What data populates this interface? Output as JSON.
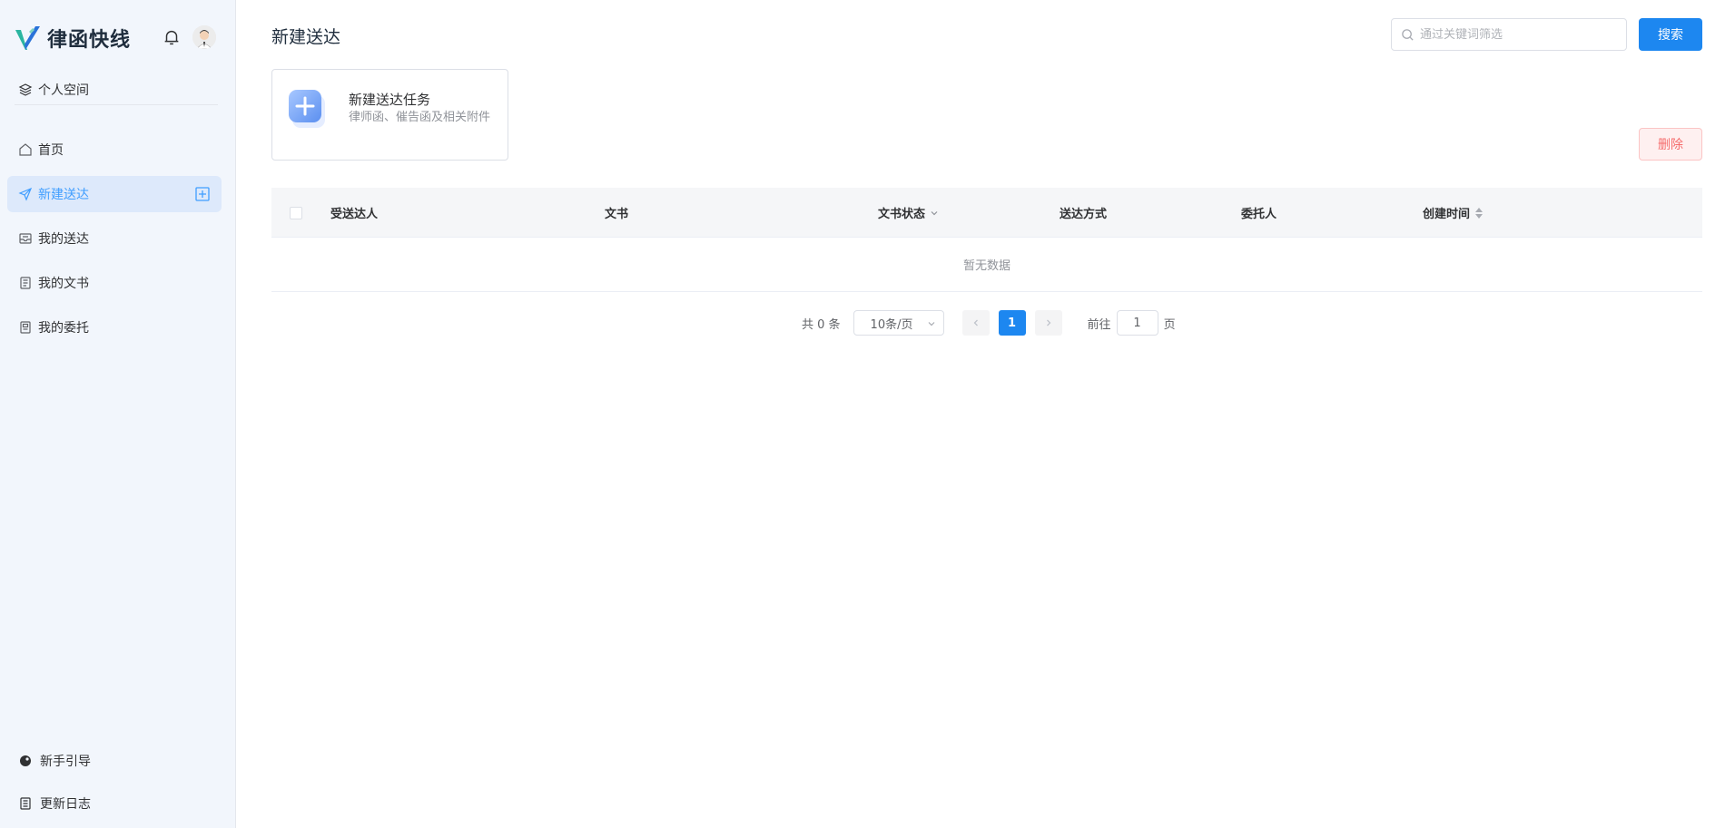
{
  "app": {
    "brand": "律函快线"
  },
  "sidebar": {
    "space_label": "个人空间",
    "items": [
      {
        "label": "首页",
        "icon": "home-icon"
      },
      {
        "label": "新建送达",
        "icon": "send-icon",
        "active": true
      },
      {
        "label": "我的送达",
        "icon": "inbox-icon"
      },
      {
        "label": "我的文书",
        "icon": "document-icon"
      },
      {
        "label": "我的委托",
        "icon": "entrust-icon"
      }
    ],
    "bottom": [
      {
        "label": "新手引导",
        "icon": "guide-icon"
      },
      {
        "label": "更新日志",
        "icon": "changelog-icon"
      }
    ]
  },
  "header": {
    "title": "新建送达",
    "search_placeholder": "通过关键词筛选",
    "search_button": "搜索"
  },
  "task_card": {
    "title": "新建送达任务",
    "desc": "律师函、催告函及相关附件"
  },
  "actions": {
    "delete": "删除"
  },
  "table": {
    "columns": [
      "受送达人",
      "文书",
      "文书状态",
      "送达方式",
      "委托人",
      "创建时间"
    ],
    "empty_text": "暂无数据"
  },
  "pagination": {
    "total_text": "共 0 条",
    "page_size": "10条/页",
    "current_page": "1",
    "goto_prefix": "前往",
    "goto_value": "1",
    "goto_suffix": "页"
  },
  "colors": {
    "primary": "#1d87f0",
    "danger": "#f56c6c",
    "sidebar_bg": "#f2f6fc",
    "active_bg": "#dde9fb"
  }
}
